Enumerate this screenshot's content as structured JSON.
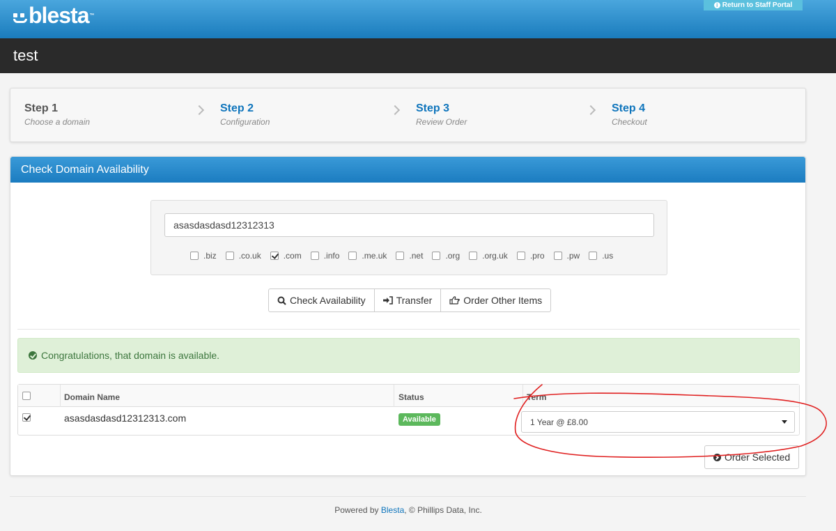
{
  "header": {
    "logo_text": "blesta",
    "logo_tm": "™",
    "staff_portal_label": "Return to Staff Portal"
  },
  "page_title": "test",
  "steps": [
    {
      "title": "Step 1",
      "subtitle": "Choose a domain",
      "active": true
    },
    {
      "title": "Step 2",
      "subtitle": "Configuration",
      "active": false
    },
    {
      "title": "Step 3",
      "subtitle": "Review Order",
      "active": false
    },
    {
      "title": "Step 4",
      "subtitle": "Checkout",
      "active": false
    }
  ],
  "panel": {
    "title": "Check Domain Availability",
    "search_value": "asasdasdasd12312313",
    "tlds": [
      {
        "label": ".biz",
        "checked": false
      },
      {
        "label": ".co.uk",
        "checked": false
      },
      {
        "label": ".com",
        "checked": true
      },
      {
        "label": ".info",
        "checked": false
      },
      {
        "label": ".me.uk",
        "checked": false
      },
      {
        "label": ".net",
        "checked": false
      },
      {
        "label": ".org",
        "checked": false
      },
      {
        "label": ".org.uk",
        "checked": false
      },
      {
        "label": ".pro",
        "checked": false
      },
      {
        "label": ".pw",
        "checked": false
      },
      {
        "label": ".us",
        "checked": false
      }
    ],
    "buttons": {
      "check": "Check Availability",
      "transfer": "Transfer",
      "other": "Order Other Items"
    },
    "alert": "Congratulations, that domain is available.",
    "table": {
      "headers": {
        "domain": "Domain Name",
        "status": "Status",
        "term": "Term"
      },
      "rows": [
        {
          "checked": true,
          "domain": "asasdasdasd12312313.com",
          "status": "Available",
          "term": "1 Year @ £8.00"
        }
      ]
    },
    "order_button": "Order Selected"
  },
  "footer": {
    "prefix": "Powered by ",
    "link": "Blesta",
    "suffix": ", © Phillips Data, Inc."
  },
  "colors": {
    "brand_blue": "#1a7cbd",
    "success": "#5cb85c",
    "annotation": "#e02020"
  }
}
